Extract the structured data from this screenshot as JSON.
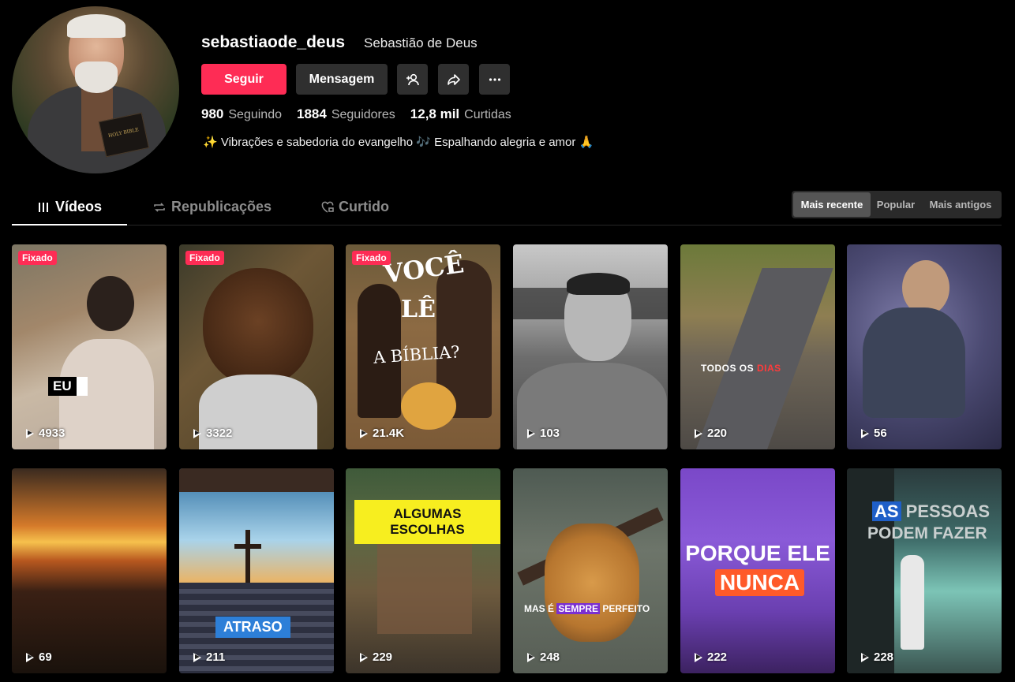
{
  "profile": {
    "username": "sebastiaode_deus",
    "nickname": "Sebastião de Deus",
    "bio": "✨ Vibrações e sabedoria do evangelho 🎶 Espalhando alegria e amor 🙏",
    "avatar_label": "avatar"
  },
  "actions": {
    "follow_label": "Seguir",
    "message_label": "Mensagem",
    "add_friend_icon": "add-friend-icon",
    "share_icon": "share-icon",
    "more_icon": "more-icon"
  },
  "stats": {
    "following_count": "980",
    "following_label": "Seguindo",
    "followers_count": "1884",
    "followers_label": "Seguidores",
    "likes_count": "12,8 mil",
    "likes_label": "Curtidas"
  },
  "tabs": {
    "videos": "Vídeos",
    "reposts": "Republicações",
    "liked": "Curtido"
  },
  "sort": {
    "latest": "Mais recente",
    "popular": "Popular",
    "oldest": "Mais antigos",
    "selected": "Mais recente"
  },
  "videos": [
    {
      "pinned": "Fixado",
      "views": "4933",
      "caption": "EU"
    },
    {
      "pinned": "Fixado",
      "views": "3322",
      "caption": ""
    },
    {
      "pinned": "Fixado",
      "views": "21.4K",
      "caption_1": "VOCÊ",
      "caption_2": "LÊ",
      "caption_3": "A BÍBLIA?"
    },
    {
      "views": "103",
      "caption": ""
    },
    {
      "views": "220",
      "caption_1": "TODOS OS ",
      "caption_2": "DIAS"
    },
    {
      "views": "56",
      "caption": ""
    },
    {
      "views": "69",
      "caption": ""
    },
    {
      "views": "211",
      "caption": "ATRASO"
    },
    {
      "views": "229",
      "caption": "ALGUMAS ESCOLHAS"
    },
    {
      "views": "248",
      "caption_1": "MAS É ",
      "caption_2": "SEMPRE",
      "caption_3": " PERFEITO"
    },
    {
      "views": "222",
      "caption_1": "PORQUE ELE",
      "caption_2": "NUNCA"
    },
    {
      "views": "228",
      "caption_1": "AS",
      "caption_2": " PESSOAS",
      "caption_3": "PODEM FAZER"
    }
  ],
  "colors": {
    "accent": "#fe2c55",
    "background": "#000000",
    "button_dark": "#2f2f2f"
  }
}
